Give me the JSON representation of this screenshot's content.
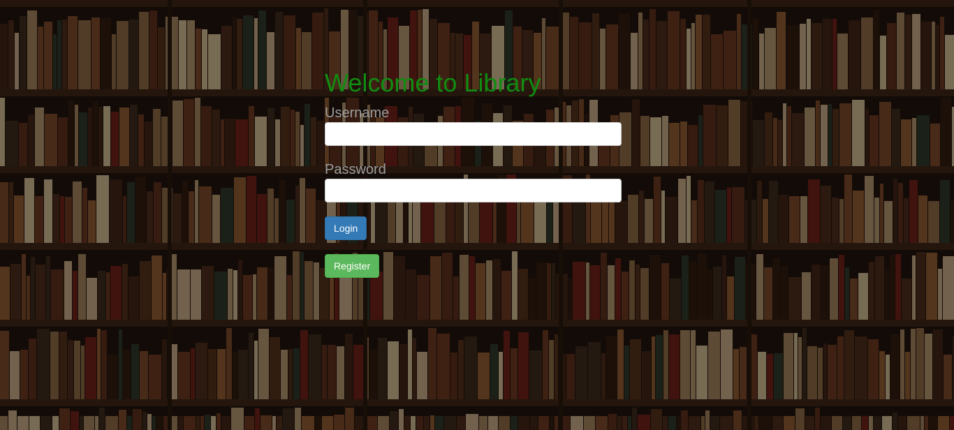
{
  "login_form": {
    "title": "Welcome to Library",
    "username_label": "Username",
    "username_value": "",
    "password_label": "Password",
    "password_value": "",
    "login_button": "Login",
    "register_button": "Register"
  },
  "colors": {
    "title": "#118c11",
    "label": "#9e9e9e",
    "login_button": "#337ab7",
    "register_button": "#5cb85c"
  }
}
